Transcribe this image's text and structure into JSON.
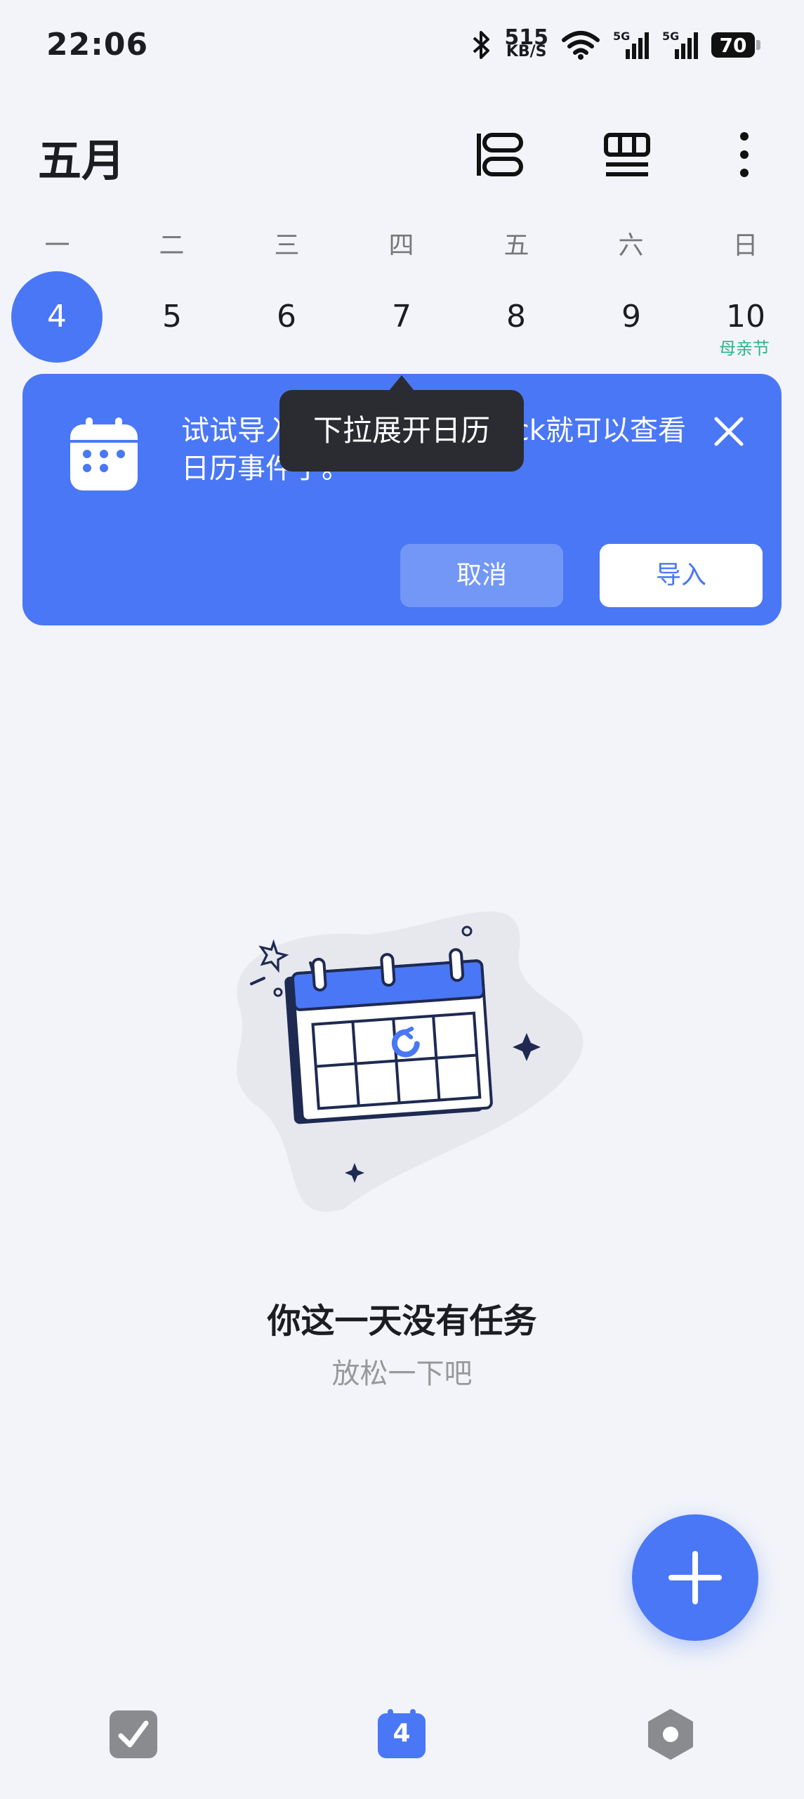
{
  "status_bar": {
    "time": "22:06",
    "net_speed_value": "515",
    "net_speed_unit": "KB/S",
    "signal_1": "5G",
    "signal_2": "5G",
    "battery": "70"
  },
  "header": {
    "title": "五月",
    "icons": [
      "timeline-view-icon",
      "grid-view-icon",
      "more-vert-icon"
    ]
  },
  "calendar": {
    "weekdays": [
      "一",
      "二",
      "三",
      "四",
      "五",
      "六",
      "日"
    ],
    "dates": [
      "4",
      "5",
      "6",
      "7",
      "8",
      "9",
      "10"
    ],
    "selected_index": 0,
    "holiday_label": "母亲节"
  },
  "banner": {
    "text": "试试导入系统日历，TickTick就可以查看日历事件了。",
    "cancel_label": "取消",
    "import_label": "导入"
  },
  "tooltip": {
    "text": "下拉展开日历"
  },
  "empty_state": {
    "title": "你这一天没有任务",
    "subtitle": "放松一下吧"
  },
  "bottom_nav": {
    "calendar_badge": "4"
  },
  "colors": {
    "accent": "#4a77f5",
    "background": "#f2f4f9",
    "holiday": "#2bb58c"
  }
}
